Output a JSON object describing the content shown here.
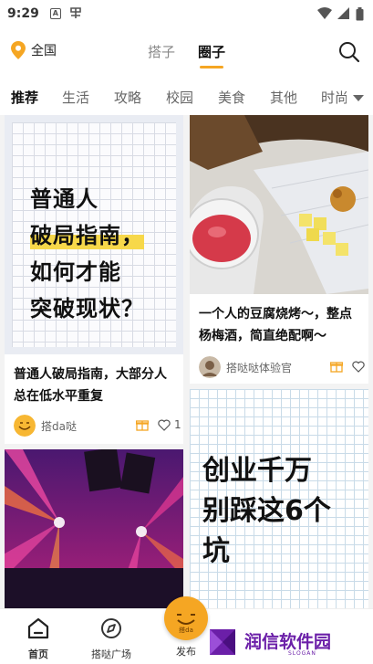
{
  "status_bar": {
    "time": "9:29"
  },
  "top_nav": {
    "location": "全国",
    "tabs": [
      {
        "label": "搭子",
        "active": false
      },
      {
        "label": "圈子",
        "active": true
      }
    ],
    "accent_color": "#f5a623"
  },
  "categories": [
    {
      "label": "推荐",
      "active": true
    },
    {
      "label": "生活"
    },
    {
      "label": "攻略"
    },
    {
      "label": "校园"
    },
    {
      "label": "美食"
    },
    {
      "label": "其他"
    },
    {
      "label": "时尚"
    }
  ],
  "posts": [
    {
      "cover_lines": [
        "普通人",
        "破局指南，",
        "如何才能",
        "突破现状？"
      ],
      "title_lines": [
        "普通人破局指南，大部分人",
        "总在低水平重复"
      ],
      "author": "搭da哒",
      "likes": "1"
    },
    {
      "title_lines": [
        "一个人的豆腐烧烤～，整点",
        "杨梅酒，简直绝配啊～"
      ],
      "author": "搭哒哒体验官"
    },
    {
      "cover_scene": "concert-stage-lights"
    },
    {
      "cover_lines": [
        "创业千万",
        "别踩这6个",
        "坑"
      ]
    }
  ],
  "bottom_nav": {
    "items": [
      {
        "label": "首页",
        "icon": "home-icon"
      },
      {
        "label": "搭哒广场",
        "icon": "compass-icon"
      },
      {
        "label": "发布",
        "icon": "publish-icon"
      }
    ],
    "publish_badge": "搭da"
  },
  "watermark": {
    "text": "润信软件园",
    "slogan": "SLOGAN"
  }
}
